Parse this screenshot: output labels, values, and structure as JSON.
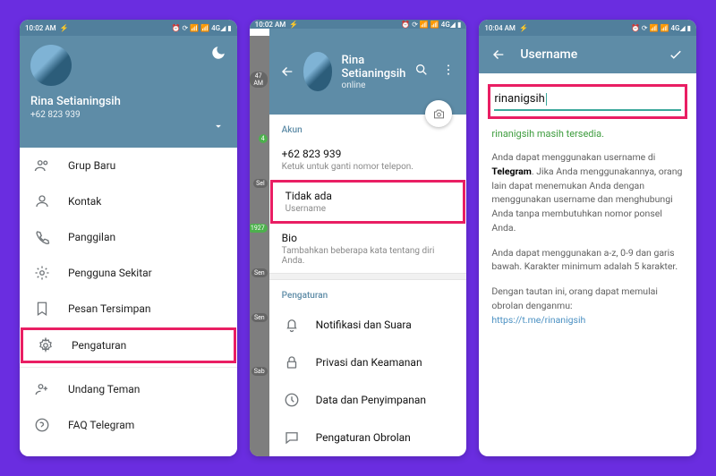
{
  "status": {
    "time1": "10:02 AM",
    "time2": "10:02 AM",
    "time3": "10:04 AM",
    "icons": "⏰ ⟳ 📶 📶 4G◢ ▮"
  },
  "p1": {
    "name": "Rina Setianingsih",
    "phone": "+62 823 939",
    "menu": [
      "Grup Baru",
      "Kontak",
      "Panggilan",
      "Pengguna Sekitar",
      "Pesan Tersimpan",
      "Pengaturan",
      "Undang Teman",
      "FAQ Telegram"
    ]
  },
  "p2": {
    "name": "Rina Setianingsih",
    "status": "online",
    "section1": "Akun",
    "phone": "+62 823 939",
    "phone_sub": "Ketuk untuk ganti nomor telepon.",
    "username_title": "Tidak ada",
    "username_sub": "Username",
    "bio_title": "Bio",
    "bio_sub": "Tambahkan beberapa kata tentang diri Anda.",
    "section2": "Pengaturan",
    "settings": [
      "Notifikasi dan Suara",
      "Privasi dan Keamanan",
      "Data dan Penyimpanan",
      "Pengaturan Obrolan"
    ],
    "badges": [
      "47 AM",
      "4",
      "Sel",
      "1927",
      "Sen",
      "Sen",
      "Sab"
    ]
  },
  "p3": {
    "title": "Username",
    "value": "rinanigsih",
    "ok": "rinanigsih masih tersedia.",
    "desc1a": "Anda dapat menggunakan username di ",
    "desc1b": "Telegram",
    "desc1c": ". Jika Anda menggunakannya, orang lain dapat menemukan Anda dengan menggunakan username dan menghubungi Anda tanpa membutuhkan nomor ponsel Anda.",
    "desc2": "Anda dapat menggunakan a-z, 0-9 dan garis bawah. Karakter minimum adalah 5 karakter.",
    "desc3": "Dengan tautan ini, orang dapat memulai obrolan denganmu:",
    "link": "https://t.me/rinanigsih"
  }
}
